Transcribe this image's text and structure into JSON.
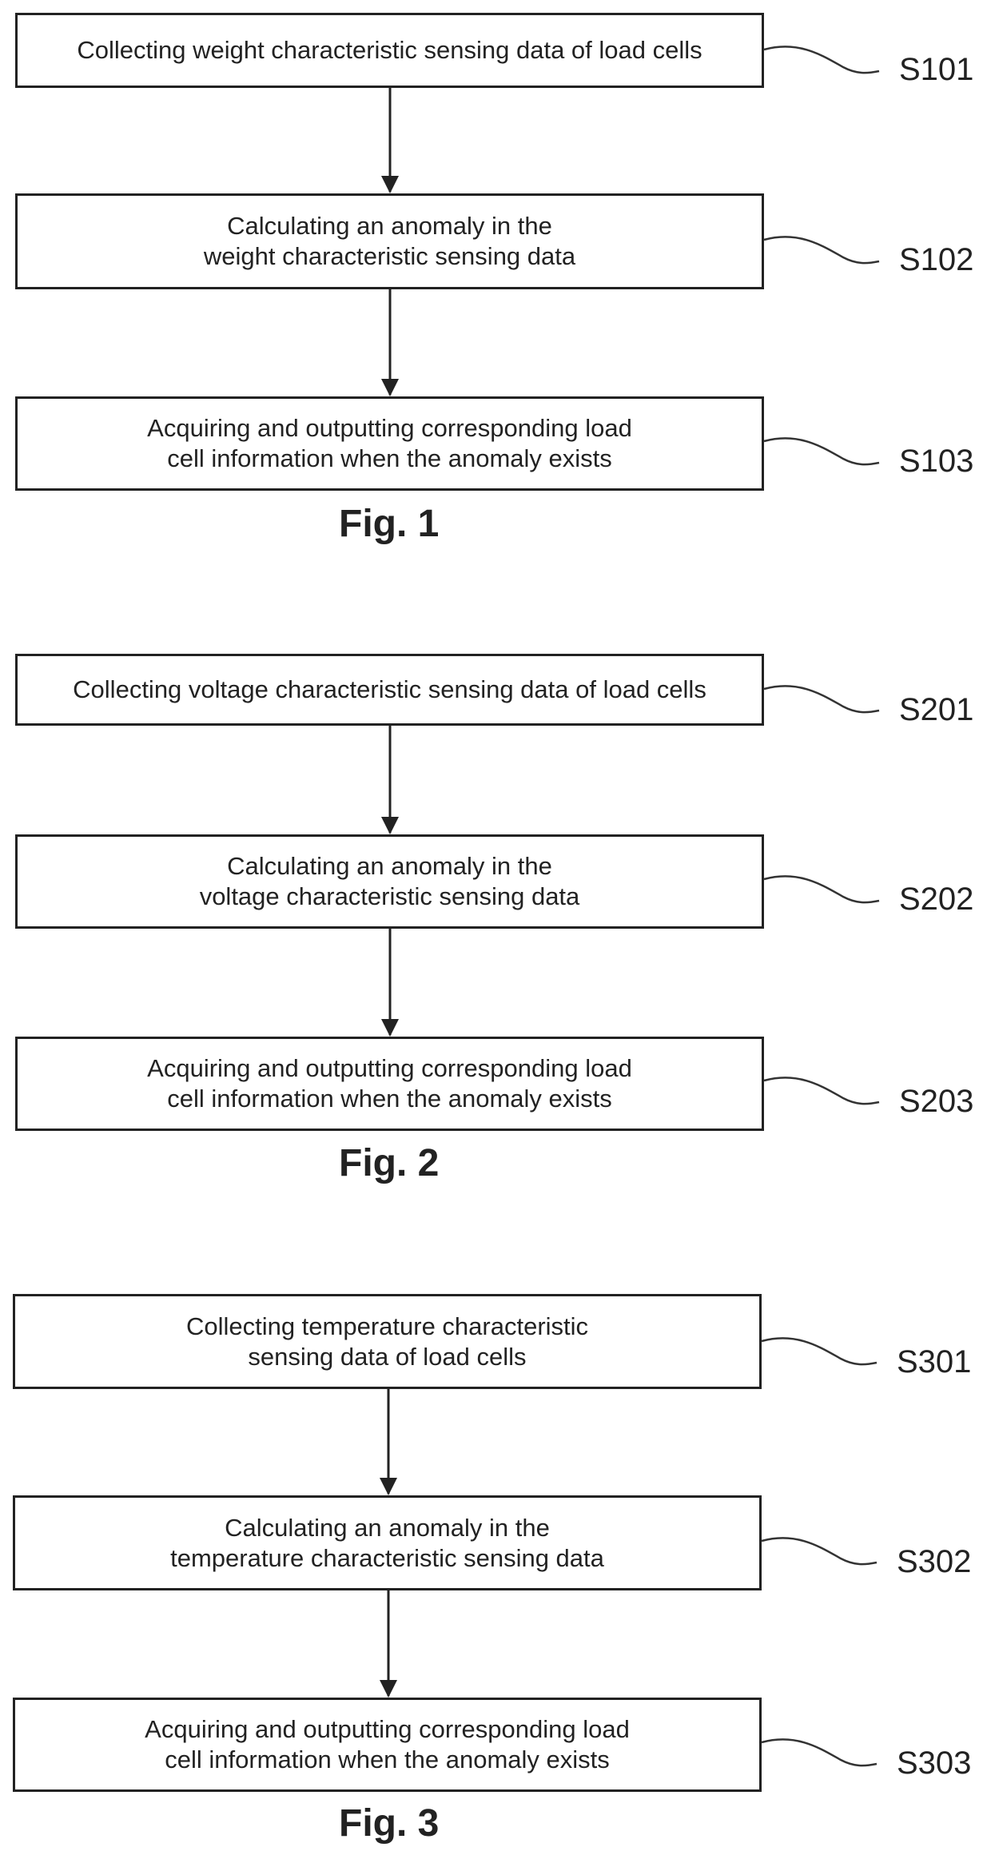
{
  "figures": [
    {
      "caption": "Fig. 1",
      "steps": [
        {
          "id": "S101",
          "text": "Collecting weight characteristic sensing data of load cells"
        },
        {
          "id": "S102",
          "text": "Calculating an anomaly in the\nweight characteristic sensing data"
        },
        {
          "id": "S103",
          "text": "Acquiring and outputting corresponding load\ncell information when the anomaly exists"
        }
      ]
    },
    {
      "caption": "Fig. 2",
      "steps": [
        {
          "id": "S201",
          "text": "Collecting voltage characteristic sensing data of load cells"
        },
        {
          "id": "S202",
          "text": "Calculating an anomaly in the\nvoltage characteristic sensing data"
        },
        {
          "id": "S203",
          "text": "Acquiring and outputting corresponding load\ncell information when the anomaly exists"
        }
      ]
    },
    {
      "caption": "Fig. 3",
      "steps": [
        {
          "id": "S301",
          "text": "Collecting temperature characteristic\nsensing data of load cells"
        },
        {
          "id": "S302",
          "text": "Calculating an anomaly in the\ntemperature characteristic sensing data"
        },
        {
          "id": "S303",
          "text": "Acquiring and outputting corresponding load\ncell information when the anomaly exists"
        }
      ]
    }
  ]
}
